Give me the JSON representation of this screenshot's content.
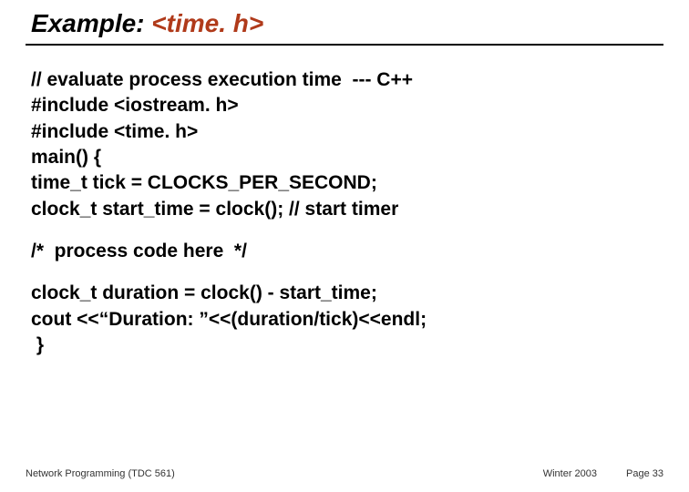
{
  "title": {
    "prefix": "Example: ",
    "accent": "<time. h>"
  },
  "code": {
    "block1": "// evaluate process execution time  --- C++\n#include <iostream. h>\n#include <time. h>\nmain() {\ntime_t tick = CLOCKS_PER_SECOND;\nclock_t start_time = clock(); // start timer",
    "block2": "/*  process code here  */",
    "block3": "clock_t duration = clock() - start_time;\ncout <<“Duration: ”<<(duration/tick)<<endl;\n }"
  },
  "footer": {
    "left": "Network Programming (TDC 561)",
    "center": "Winter 2003",
    "right": "Page 33"
  }
}
